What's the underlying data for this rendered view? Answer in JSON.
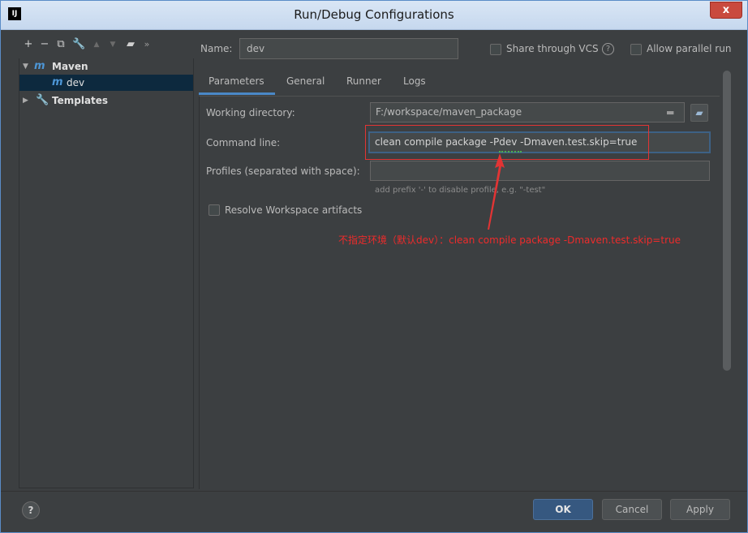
{
  "window": {
    "title": "Run/Debug Configurations",
    "app_icon": "IJ",
    "close_label": "x"
  },
  "toolbar": {
    "icons": [
      "plus-icon",
      "minus-icon",
      "copy-icon",
      "wrench-icon",
      "arrow-up-icon",
      "arrow-down-icon",
      "folder-add-icon",
      "more-icon"
    ]
  },
  "tree": {
    "items": [
      {
        "label": "Maven",
        "icon": "maven-icon",
        "expanded": true
      },
      {
        "label": "dev",
        "icon": "maven-icon",
        "selected": true
      },
      {
        "label": "Templates",
        "icon": "wrench-icon",
        "expanded": false
      }
    ]
  },
  "config": {
    "name_label": "Name:",
    "name_value": "dev",
    "share_label": "Share through VCS",
    "parallel_label": "Allow parallel run"
  },
  "tabs": [
    "Parameters",
    "General",
    "Runner",
    "Logs"
  ],
  "params": {
    "working_dir_label": "Working directory:",
    "working_dir_value": "F:/workspace/maven_package",
    "cmd_label": "Command line:",
    "cmd_value": "clean compile package -Pdev -Dmaven.test.skip=true",
    "profiles_label": "Profiles (separated with space):",
    "profiles_value": "",
    "profiles_hint": "add prefix '-' to disable profile, e.g. \"-test\"",
    "resolve_label": "Resolve Workspace artifacts"
  },
  "annotation": {
    "text": "不指定环境（默认dev）：clean compile package  -Dmaven.test.skip=true",
    "color": "#ee2b2b"
  },
  "buttons": {
    "help": "?",
    "ok": "OK",
    "cancel": "Cancel",
    "apply": "Apply"
  }
}
